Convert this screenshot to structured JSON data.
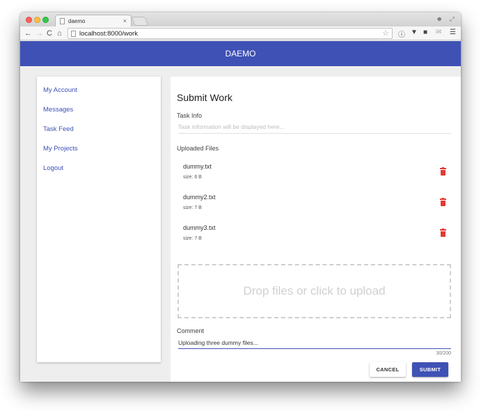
{
  "browser": {
    "tab_title": "daemo",
    "tab_close": "×",
    "url": "localhost:8000/work",
    "nav": {
      "back": "←",
      "forward": "→",
      "reload": "C",
      "home": "⌂"
    },
    "star": "☆"
  },
  "app": {
    "title": "DAEMO",
    "accent_color": "#3f51b5",
    "delete_color": "#e53935"
  },
  "sidebar": {
    "items": [
      {
        "label": "My Account"
      },
      {
        "label": "Messages"
      },
      {
        "label": "Task Feed"
      },
      {
        "label": "My Projects"
      },
      {
        "label": "Logout"
      }
    ]
  },
  "main": {
    "title": "Submit Work",
    "task_info": {
      "label": "Task Info",
      "placeholder": "Task information will be displayed here..."
    },
    "uploaded_files": {
      "label": "Uploaded Files",
      "files": [
        {
          "name": "dummy.txt",
          "size": "size: 6 B"
        },
        {
          "name": "dummy2.txt",
          "size": "size: 7 B"
        },
        {
          "name": "dummy3.txt",
          "size": "size: 7 B"
        }
      ]
    },
    "dropzone_text": "Drop files or click to upload",
    "comment": {
      "label": "Comment",
      "value": "Uploading three dummy files...",
      "counter": "30/200"
    },
    "buttons": {
      "cancel": "CANCEL",
      "submit": "SUBMIT"
    }
  }
}
